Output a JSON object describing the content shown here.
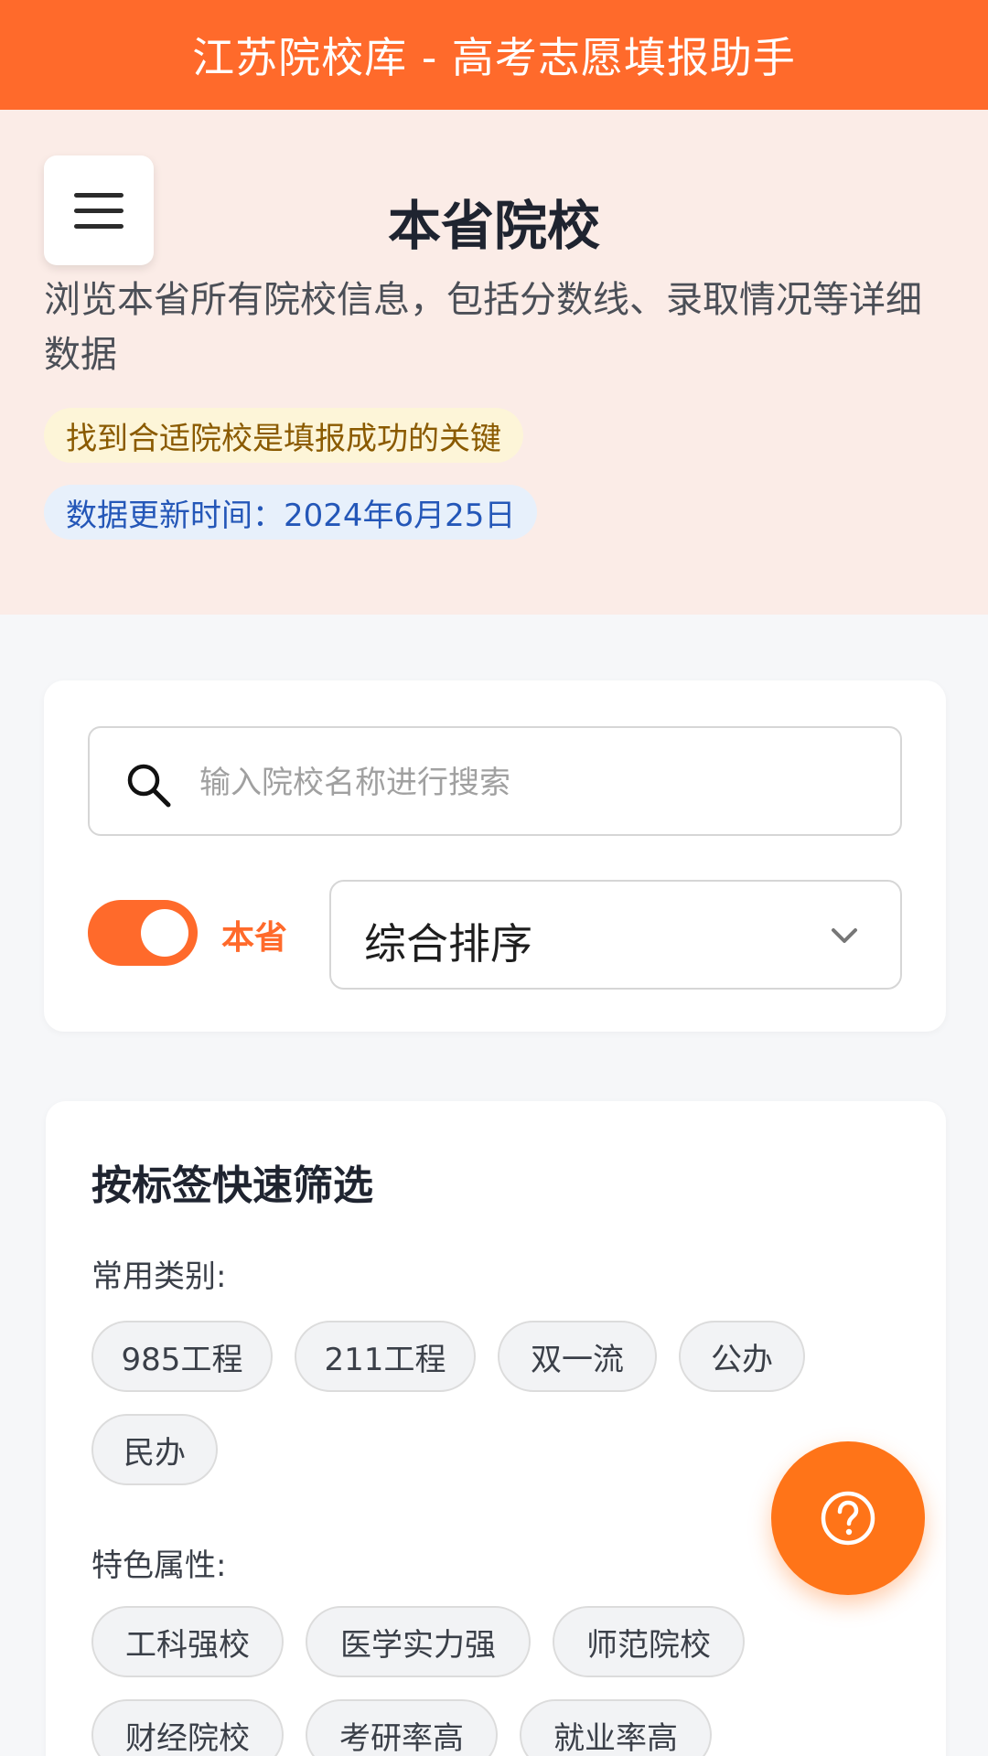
{
  "header": {
    "title": "江苏院校库 - 高考志愿填报助手"
  },
  "hero": {
    "menu_icon": "hamburger-menu-icon",
    "title": "本省院校",
    "description": "浏览本省所有院校信息，包括分数线、录取情况等详细数据",
    "tip": "找到合适院校是填报成功的关键",
    "update_time": "数据更新时间：2024年6月25日"
  },
  "search": {
    "icon": "search-icon",
    "placeholder": "输入院校名称进行搜索",
    "value": ""
  },
  "filters_bar": {
    "province_toggle": {
      "label": "本省",
      "on": true
    },
    "sort_select": {
      "value": "综合排序",
      "icon": "chevron-down-icon"
    }
  },
  "tag_filter": {
    "title": "按标签快速筛选",
    "groups": [
      {
        "label": "常用类别:",
        "tags": [
          "985工程",
          "211工程",
          "双一流",
          "公办",
          "民办"
        ]
      },
      {
        "label": "特色属性:",
        "tags": [
          "工科强校",
          "医学实力强",
          "师范院校",
          "财经院校",
          "考研率高",
          "就业率高"
        ]
      }
    ]
  },
  "fab": {
    "icon": "help-circle-icon"
  },
  "colors": {
    "accent": "#ff6a2b",
    "hero_bg": "#fbece7",
    "tip_bg": "#fdf5d8",
    "date_bg": "#e7f0fb"
  }
}
